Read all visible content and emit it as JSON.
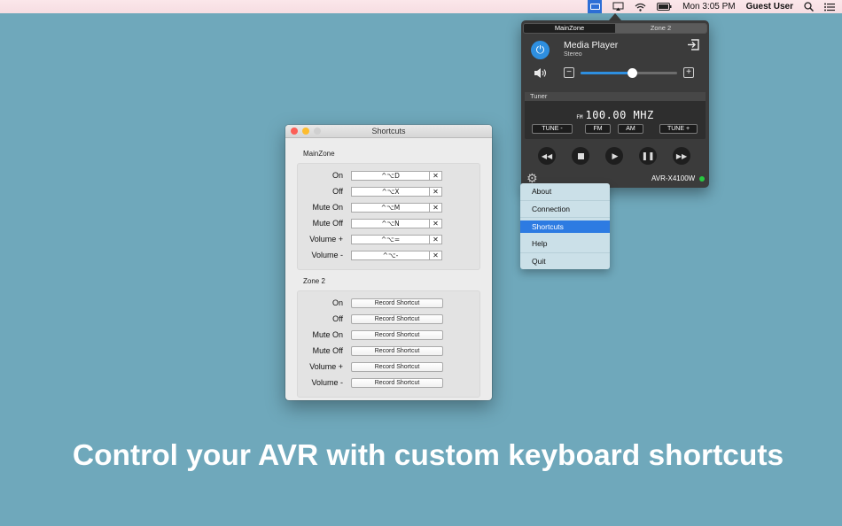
{
  "menubar": {
    "app_icon": "avr-menubar-icon",
    "airplay_icon": "airplay-icon",
    "wifi_icon": "wifi-icon",
    "battery_icon": "battery-icon",
    "clock": "Mon 3:05 PM",
    "user": "Guest User",
    "search_icon": "search-icon",
    "list_icon": "list-icon"
  },
  "shortcuts_window": {
    "title": "Shortcuts",
    "mainzone": {
      "label": "MainZone",
      "rows": [
        {
          "label": "On",
          "shortcut": "^⌥D"
        },
        {
          "label": "Off",
          "shortcut": "^⌥X"
        },
        {
          "label": "Mute On",
          "shortcut": "^⌥M"
        },
        {
          "label": "Mute Off",
          "shortcut": "^⌥N"
        },
        {
          "label": "Volume +",
          "shortcut": "^⌥="
        },
        {
          "label": "Volume -",
          "shortcut": "^⌥-"
        }
      ],
      "clear_symbol": "✕"
    },
    "zone2": {
      "label": "Zone 2",
      "rows": [
        {
          "label": "On",
          "button": "Record Shortcut"
        },
        {
          "label": "Off",
          "button": "Record Shortcut"
        },
        {
          "label": "Mute On",
          "button": "Record Shortcut"
        },
        {
          "label": "Mute Off",
          "button": "Record Shortcut"
        },
        {
          "label": "Volume +",
          "button": "Record Shortcut"
        },
        {
          "label": "Volume -",
          "button": "Record Shortcut"
        }
      ]
    }
  },
  "avr_popover": {
    "tabs": [
      "MainZone",
      "Zone 2"
    ],
    "active_tab": "MainZone",
    "source": "Media Player",
    "mode": "Stereo",
    "volume_level": 0.53,
    "tuner": {
      "label": "Tuner",
      "band": "FM",
      "frequency": "100.00 MHZ",
      "buttons": [
        "TUNE -",
        "FM",
        "AM",
        "TUNE +"
      ]
    },
    "device": "AVR-X4100W",
    "status_color": "#28c940",
    "accent_color": "#2e8fe0"
  },
  "gear_menu": {
    "items": [
      "About",
      "Connection",
      "Shortcuts",
      "Help",
      "Quit"
    ],
    "selected": "Shortcuts"
  },
  "tagline": "Control your AVR with custom keyboard shortcuts"
}
